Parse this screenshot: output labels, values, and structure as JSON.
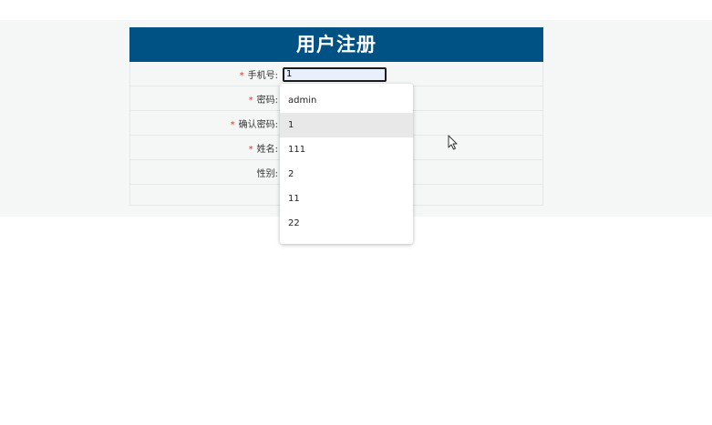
{
  "form": {
    "title": "用户注册",
    "required_mark": "*",
    "phone_label": "手机号:",
    "phone_value": "1",
    "password_label": "密码:",
    "confirm_password_label": "确认密码:",
    "name_label": "姓名:",
    "gender_label": "性别:"
  },
  "autocomplete": {
    "items": [
      "admin",
      "1",
      "111",
      "2",
      "11",
      "22"
    ],
    "active_index": 1
  },
  "colors": {
    "header_bg": "#005284",
    "required": "#e0332b",
    "input_autofill_bg": "#e8f0fe"
  }
}
